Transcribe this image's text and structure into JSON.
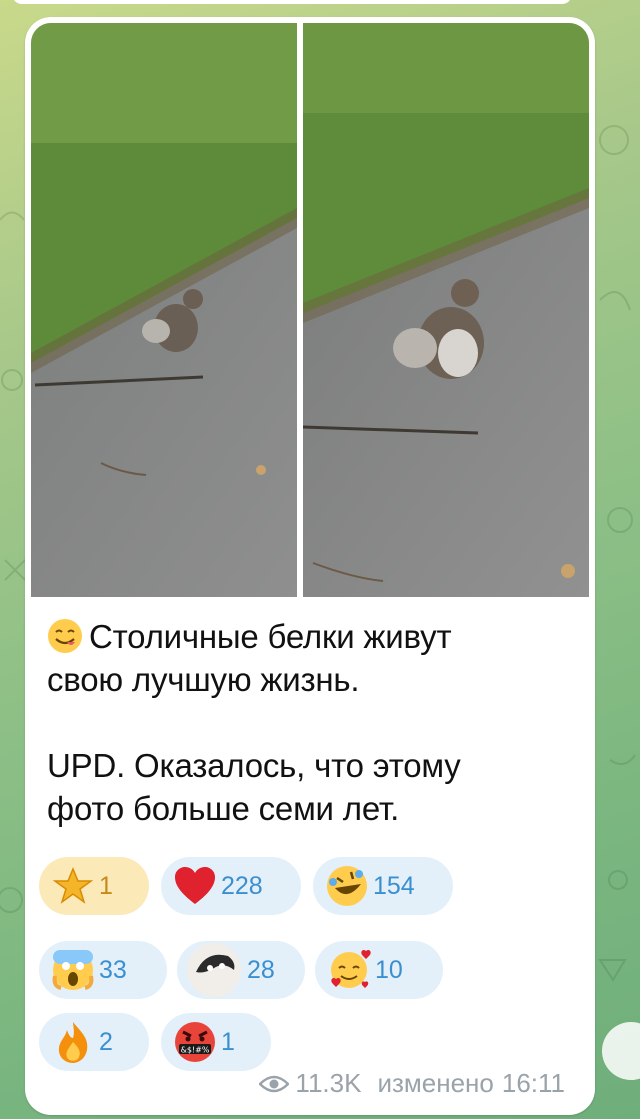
{
  "post": {
    "caption_line1": "Столичные белки живут",
    "caption_line2": "свою лучшую жизнь.",
    "caption_line3": "UPD. Оказалось, что этому",
    "caption_line4": "фото больше семи лет.",
    "caption_emoji": "yum-face-icon"
  },
  "reactions": [
    {
      "icon": "star-icon",
      "count": "1",
      "active": true
    },
    {
      "icon": "red-heart-icon",
      "count": "228"
    },
    {
      "icon": "rolling-laughing-face-icon",
      "count": "154"
    },
    {
      "icon": "screaming-face-icon",
      "count": "33"
    },
    {
      "icon": "custom-cat-icon",
      "count": "28"
    },
    {
      "icon": "smiling-face-hearts-icon",
      "count": "10"
    },
    {
      "icon": "fire-icon",
      "count": "2"
    },
    {
      "icon": "cursing-face-icon",
      "count": "1"
    }
  ],
  "footer": {
    "views": "11.3K",
    "edited_label": "изменено",
    "time": "16:11"
  }
}
